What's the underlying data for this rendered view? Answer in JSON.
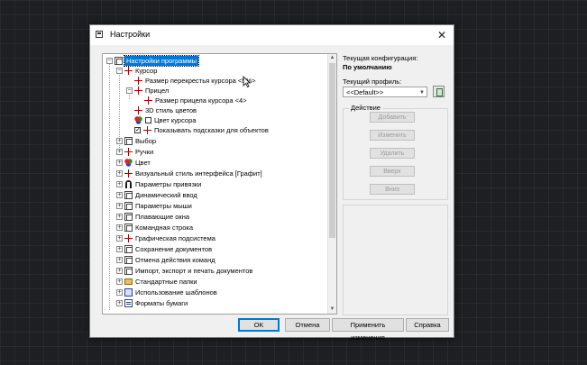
{
  "dialog": {
    "title": "Настройки",
    "close": "✕"
  },
  "tree": {
    "nodes": [
      {
        "label": "Настройки программы",
        "selected": true
      },
      {
        "label": "Курсор"
      },
      {
        "label": "Размер перекрестья курсора <5%>"
      },
      {
        "label": "Прицел"
      },
      {
        "label": "Размер прицела курсора <4>"
      },
      {
        "label": "3D стиль цветов"
      },
      {
        "label": "Цвет курсора"
      },
      {
        "label": "Показывать подсказки для объектов"
      },
      {
        "label": "Выбор"
      },
      {
        "label": "Ручки"
      },
      {
        "label": "Цвет"
      },
      {
        "label": "Визуальный стиль интерфейса [Графит]"
      },
      {
        "label": "Параметры привязки"
      },
      {
        "label": "Динамический ввод"
      },
      {
        "label": "Параметры мыши"
      },
      {
        "label": "Плавающие окна"
      },
      {
        "label": "Командная строка"
      },
      {
        "label": "Графическая подсистема"
      },
      {
        "label": "Сохранение документов"
      },
      {
        "label": "Отмена действия команд"
      },
      {
        "label": "Импорт, экспорт и печать документов"
      },
      {
        "label": "Стандартные папки"
      },
      {
        "label": "Использование шаблонов"
      },
      {
        "label": "Форматы бумаги"
      }
    ],
    "checks": {
      "show_tooltips": "✓"
    },
    "icons": [
      "options-icon",
      "cursor-icon",
      "grip-icon",
      "color-icon",
      "folder-icon",
      "template-icon",
      "paper-icon"
    ]
  },
  "config": {
    "current_config_label": "Текущая конфигурация:",
    "current_config_value": "По умолчанию",
    "current_profile_label": "Текущий профиль:",
    "profile_value": "<<Default>>"
  },
  "actions": {
    "title": "Действие",
    "add": "Добавить",
    "edit": "Изменить",
    "delete": "Удалить",
    "up": "Вверх",
    "down": "Вниз"
  },
  "footer": {
    "ok": "OK",
    "cancel": "Отмена",
    "apply": "Применить изменения",
    "help": "Справка"
  },
  "colors": {
    "accent": "#0078d7",
    "background": "#1d1f22"
  }
}
